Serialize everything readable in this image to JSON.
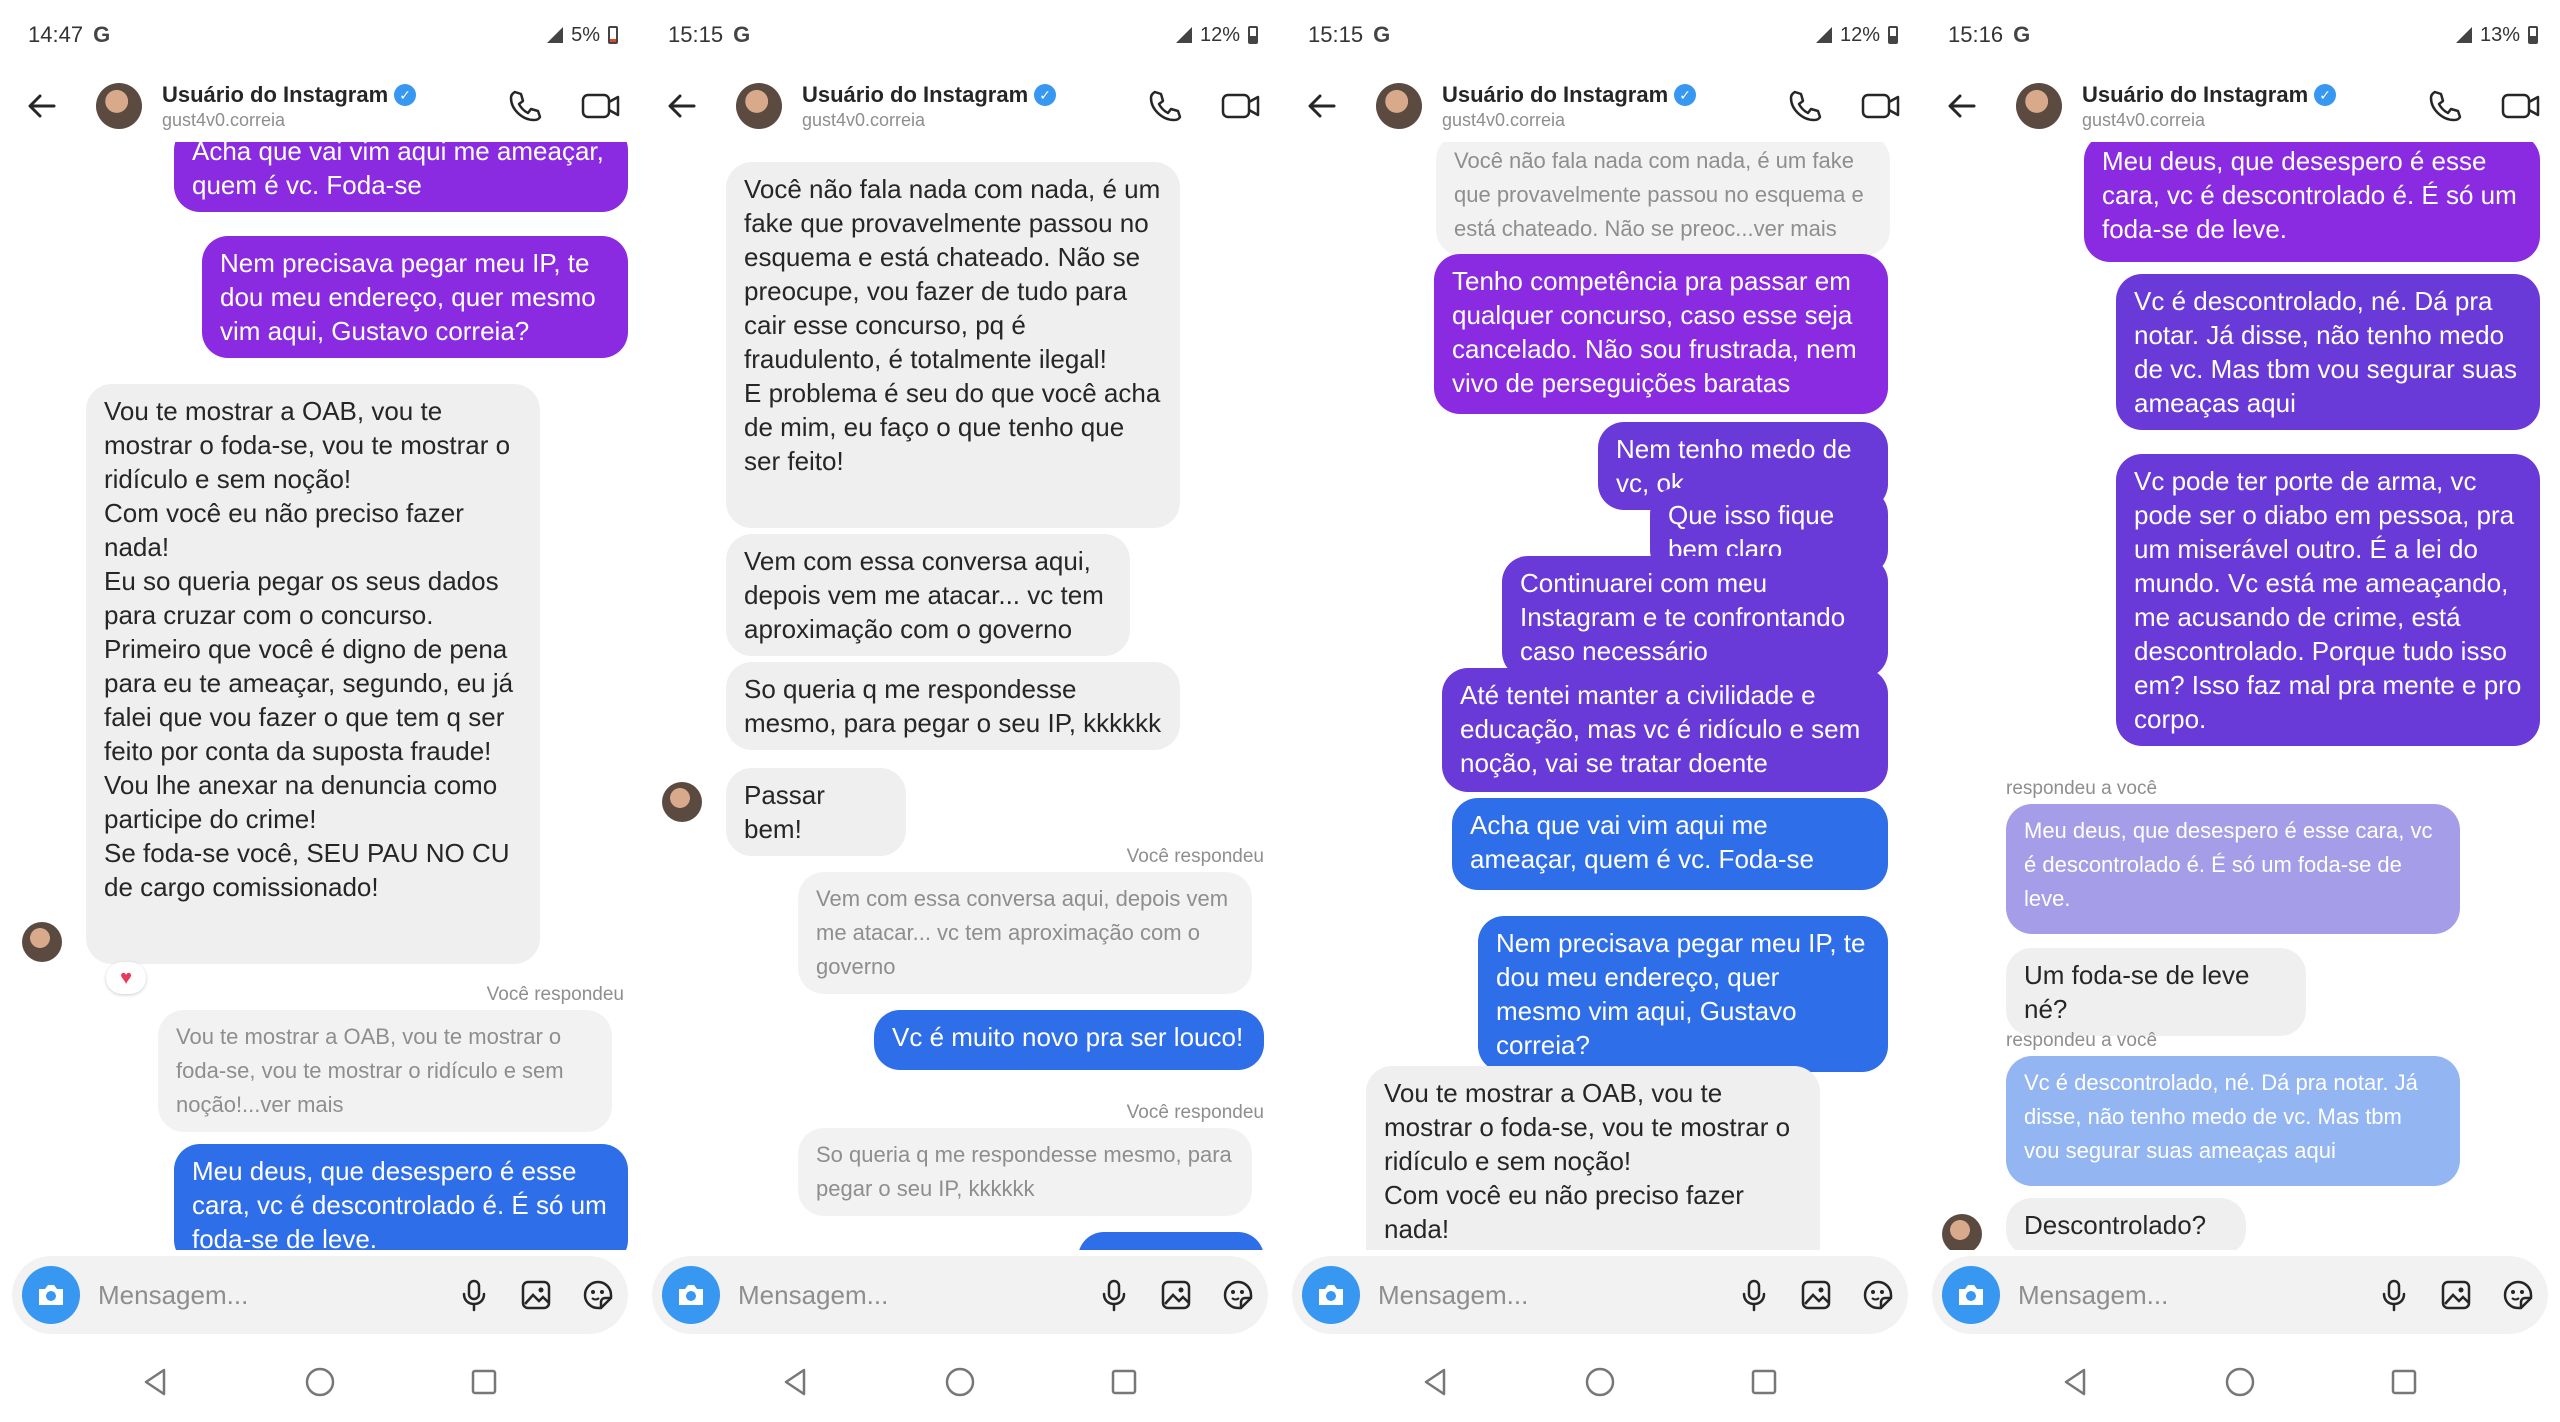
{
  "header": {
    "name": "Usuário do Instagram",
    "username": "gust4v0.correia"
  },
  "composer": {
    "placeholder": "Mensagem..."
  },
  "colors": {
    "purple": "#8a2be2",
    "violet": "#6a3ad8",
    "blue": "#2f6ee9",
    "ig_blue": "#3897f0"
  },
  "icons": [
    "back-arrow-icon",
    "verified-badge-icon",
    "phone-icon",
    "video-icon",
    "camera-icon",
    "microphone-icon",
    "gallery-icon",
    "sticker-icon",
    "heart-icon",
    "nav-back-icon",
    "nav-home-icon",
    "nav-recents-icon"
  ],
  "screens": [
    {
      "time": "14:47",
      "battery": "5%",
      "messages": {
        "m1": "Acha que vai vim aqui me ameaçar, quem é vc. Foda-se",
        "m2": "Nem precisava pegar meu IP, te dou meu endereço, quer mesmo vim aqui, Gustavo correia?",
        "m3": "Vou te mostrar a OAB, vou te mostrar o foda-se, vou te mostrar o ridículo e sem noção!\nCom você eu não preciso fazer nada!\nEu so queria pegar os seus dados para cruzar com o concurso.\nPrimeiro que você é digno de pena para eu te ameaçar, segundo, eu já falei que vou fazer o que tem q ser feito por conta da suposta fraude!\nVou lhe anexar na denuncia como participe do crime!\nSe foda-se você, SEU PAU NO CU de cargo comissionado!",
        "label1": "Você respondeu",
        "q1": "Vou te mostrar a OAB, vou te mostrar o foda-se, vou te mostrar o ridículo e sem noção!...ver mais",
        "m4": "Meu deus, que desespero é esse cara, vc é descontrolado é. É só um foda-se de leve."
      }
    },
    {
      "time": "15:15",
      "battery": "12%",
      "messages": {
        "m1": "Você não fala nada com nada, é um fake que provavelmente passou no esquema e está chateado. Não se preocupe, vou fazer de tudo para cair esse concurso, pq é fraudulento, é totalmente ilegal!\nE problema é seu do que você acha de mim, eu faço o que tenho que ser feito!",
        "m2": "Vem com essa conversa aqui, depois vem me atacar... vc tem aproximação com o governo",
        "m3": "So queria q me respondesse mesmo, para pegar o seu IP, kkkkkk",
        "m4": "Passar bem!",
        "label1": "Você respondeu",
        "q1": "Vem com essa conversa aqui, depois vem me atacar... vc tem aproximação com o governo",
        "m5": "Vc é muito novo pra ser louco!",
        "label2": "Você respondeu",
        "q2": "So queria q me respondesse mesmo, para pegar o seu IP, kkkkkk"
      }
    },
    {
      "time": "15:15",
      "battery": "12%",
      "messages": {
        "q1": "Você não fala nada com nada, é um fake que provavelmente passou no esquema e está chateado. Não se preoc...ver mais",
        "m1": "Tenho competência pra passar em qualquer concurso, caso esse seja cancelado. Não sou frustrada, nem vivo de perseguições baratas",
        "m2": "Nem tenho medo de vc, ok",
        "m3": "Que isso fique bem claro",
        "m4": "Continuarei com meu Instagram e te confrontando caso necessário",
        "m5": "Até tentei manter a civilidade e educação, mas vc é ridículo e sem noção, vai se tratar doente",
        "m6": "Acha que vai vim aqui me ameaçar, quem é vc. Foda-se",
        "m7": "Nem precisava pegar meu IP, te dou meu endereço, quer mesmo vim aqui, Gustavo correia?",
        "m8": "Vou te mostrar a OAB, vou te mostrar o foda-se, vou te mostrar o ridículo e sem noção!\nCom você eu não preciso fazer nada!\nEu so queria pegar os seus dados"
      }
    },
    {
      "time": "15:16",
      "battery": "13%",
      "messages": {
        "m1": "Meu deus, que desespero é esse cara, vc é descontrolado é. É só um foda-se de leve.",
        "m2": "Vc é descontrolado, né. Dá pra notar. Já disse, não tenho medo de vc. Mas tbm vou segurar suas ameaças aqui",
        "m3": "Vc pode ter porte de arma, vc pode ser o diabo em pessoa, pra um miserável outro. É a lei do mundo. Vc está me ameaçando, me acusando de crime, está descontrolado. Porque tudo isso em? Isso faz mal pra mente e pro corpo.",
        "label1": "respondeu a você",
        "q1": "Meu deus, que desespero é esse cara, vc é descontrolado é. É só um foda-se de leve.",
        "m4": "Um foda-se de leve né?",
        "label2": "respondeu a você",
        "q2": "Vc é descontrolado, né. Dá pra notar. Já disse, não tenho medo de vc. Mas tbm vou segurar suas ameaças aqui",
        "m5": "Descontrolado?"
      }
    }
  ]
}
